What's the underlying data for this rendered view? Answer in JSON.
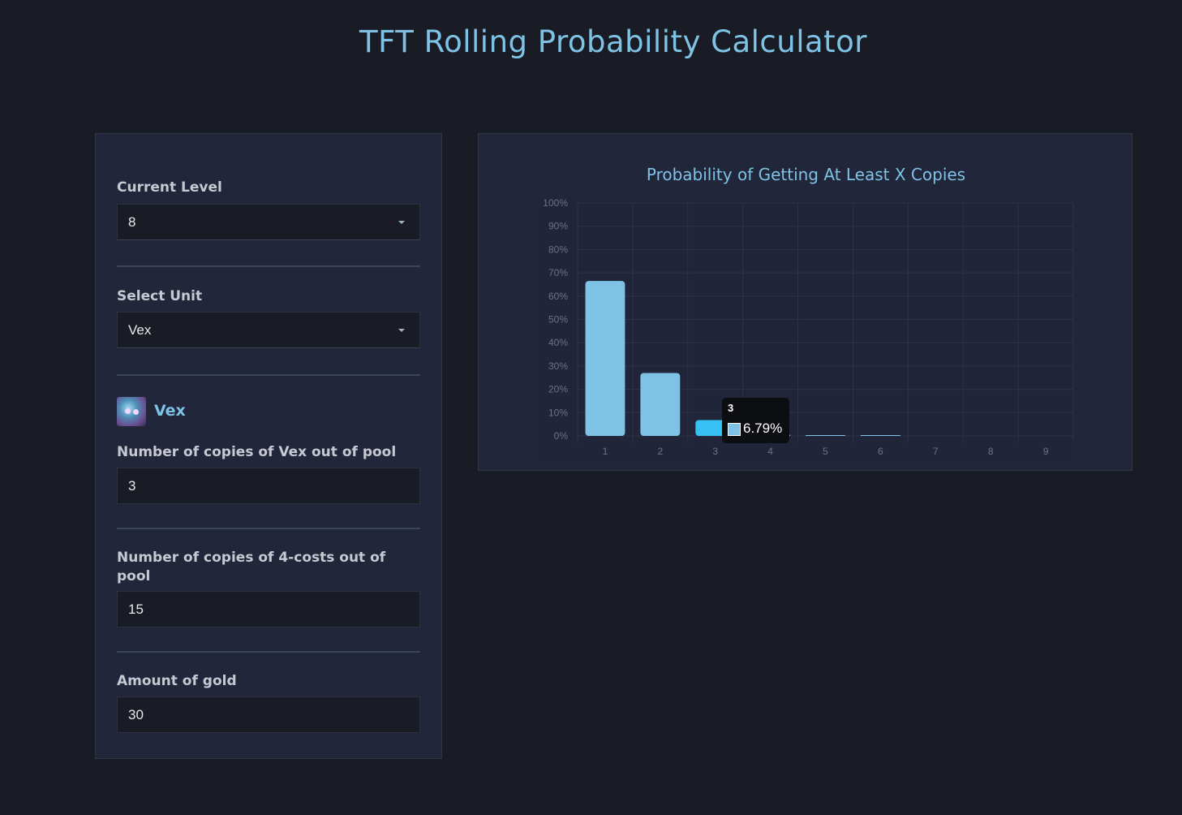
{
  "page": {
    "title": "TFT Rolling Probability Calculator"
  },
  "form": {
    "level": {
      "label": "Current Level",
      "value": "8"
    },
    "unit_select": {
      "label": "Select Unit",
      "value": "Vex"
    },
    "unit": {
      "name": "Vex",
      "icon": "vex-portrait-icon"
    },
    "copies_out": {
      "label": "Number of copies of Vex out of pool",
      "value": "3"
    },
    "cost_copies_out": {
      "label": "Number of copies of 4-costs out of pool",
      "value": "15"
    },
    "gold": {
      "label": "Amount of gold",
      "value": "30"
    }
  },
  "colors": {
    "accent": "#7ec3e6",
    "bar": "#7ec3e6",
    "bar_hover": "#36c1f5",
    "background": "#191c24",
    "card": "#22263a"
  },
  "chart_data": {
    "type": "bar",
    "title": "Probability of Getting At Least X Copies",
    "categories": [
      "1",
      "2",
      "3",
      "4",
      "5",
      "6",
      "7",
      "8",
      "9"
    ],
    "values": [
      66.5,
      27.0,
      6.79,
      0.5,
      0.1,
      0.02,
      0,
      0,
      0
    ],
    "ylim": [
      0,
      100
    ],
    "ytick_labels": [
      "100%",
      "90%",
      "80%",
      "70%",
      "60%",
      "50%",
      "40%",
      "30%",
      "20%",
      "10%",
      "0%"
    ],
    "grid": true,
    "highlighted_index": 2,
    "tooltip": {
      "title": "3",
      "value": "6.79%"
    }
  }
}
